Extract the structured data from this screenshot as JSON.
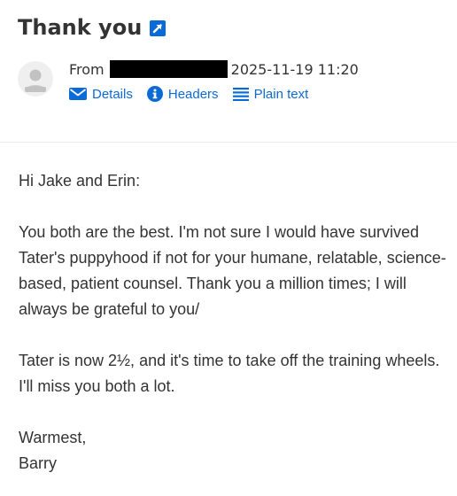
{
  "email": {
    "subject": "Thank you",
    "from_label": "From",
    "date": "2025-11-19 11:20",
    "actions": {
      "details": "Details",
      "headers": "Headers",
      "plain_text": "Plain text"
    },
    "body": {
      "greeting": "Hi Jake and Erin:",
      "paragraph1": "You both are the best. I'm not sure I would have survived Tater's puppyhood if not for your humane, relatable, science-based, patient counsel. Thank you a million times; I will always be grateful to you/",
      "paragraph2": "Tater is now 2½, and it's time to take off the training wheels. I'll miss you both a lot.",
      "closing": "Warmest,",
      "signature": "Barry"
    }
  },
  "colors": {
    "link": "#0b6bd6",
    "text": "#333333",
    "redaction": "#000000"
  },
  "icons": [
    "open-in-new-window-icon",
    "envelope-icon",
    "info-icon",
    "lines-icon",
    "user-avatar-icon"
  ]
}
